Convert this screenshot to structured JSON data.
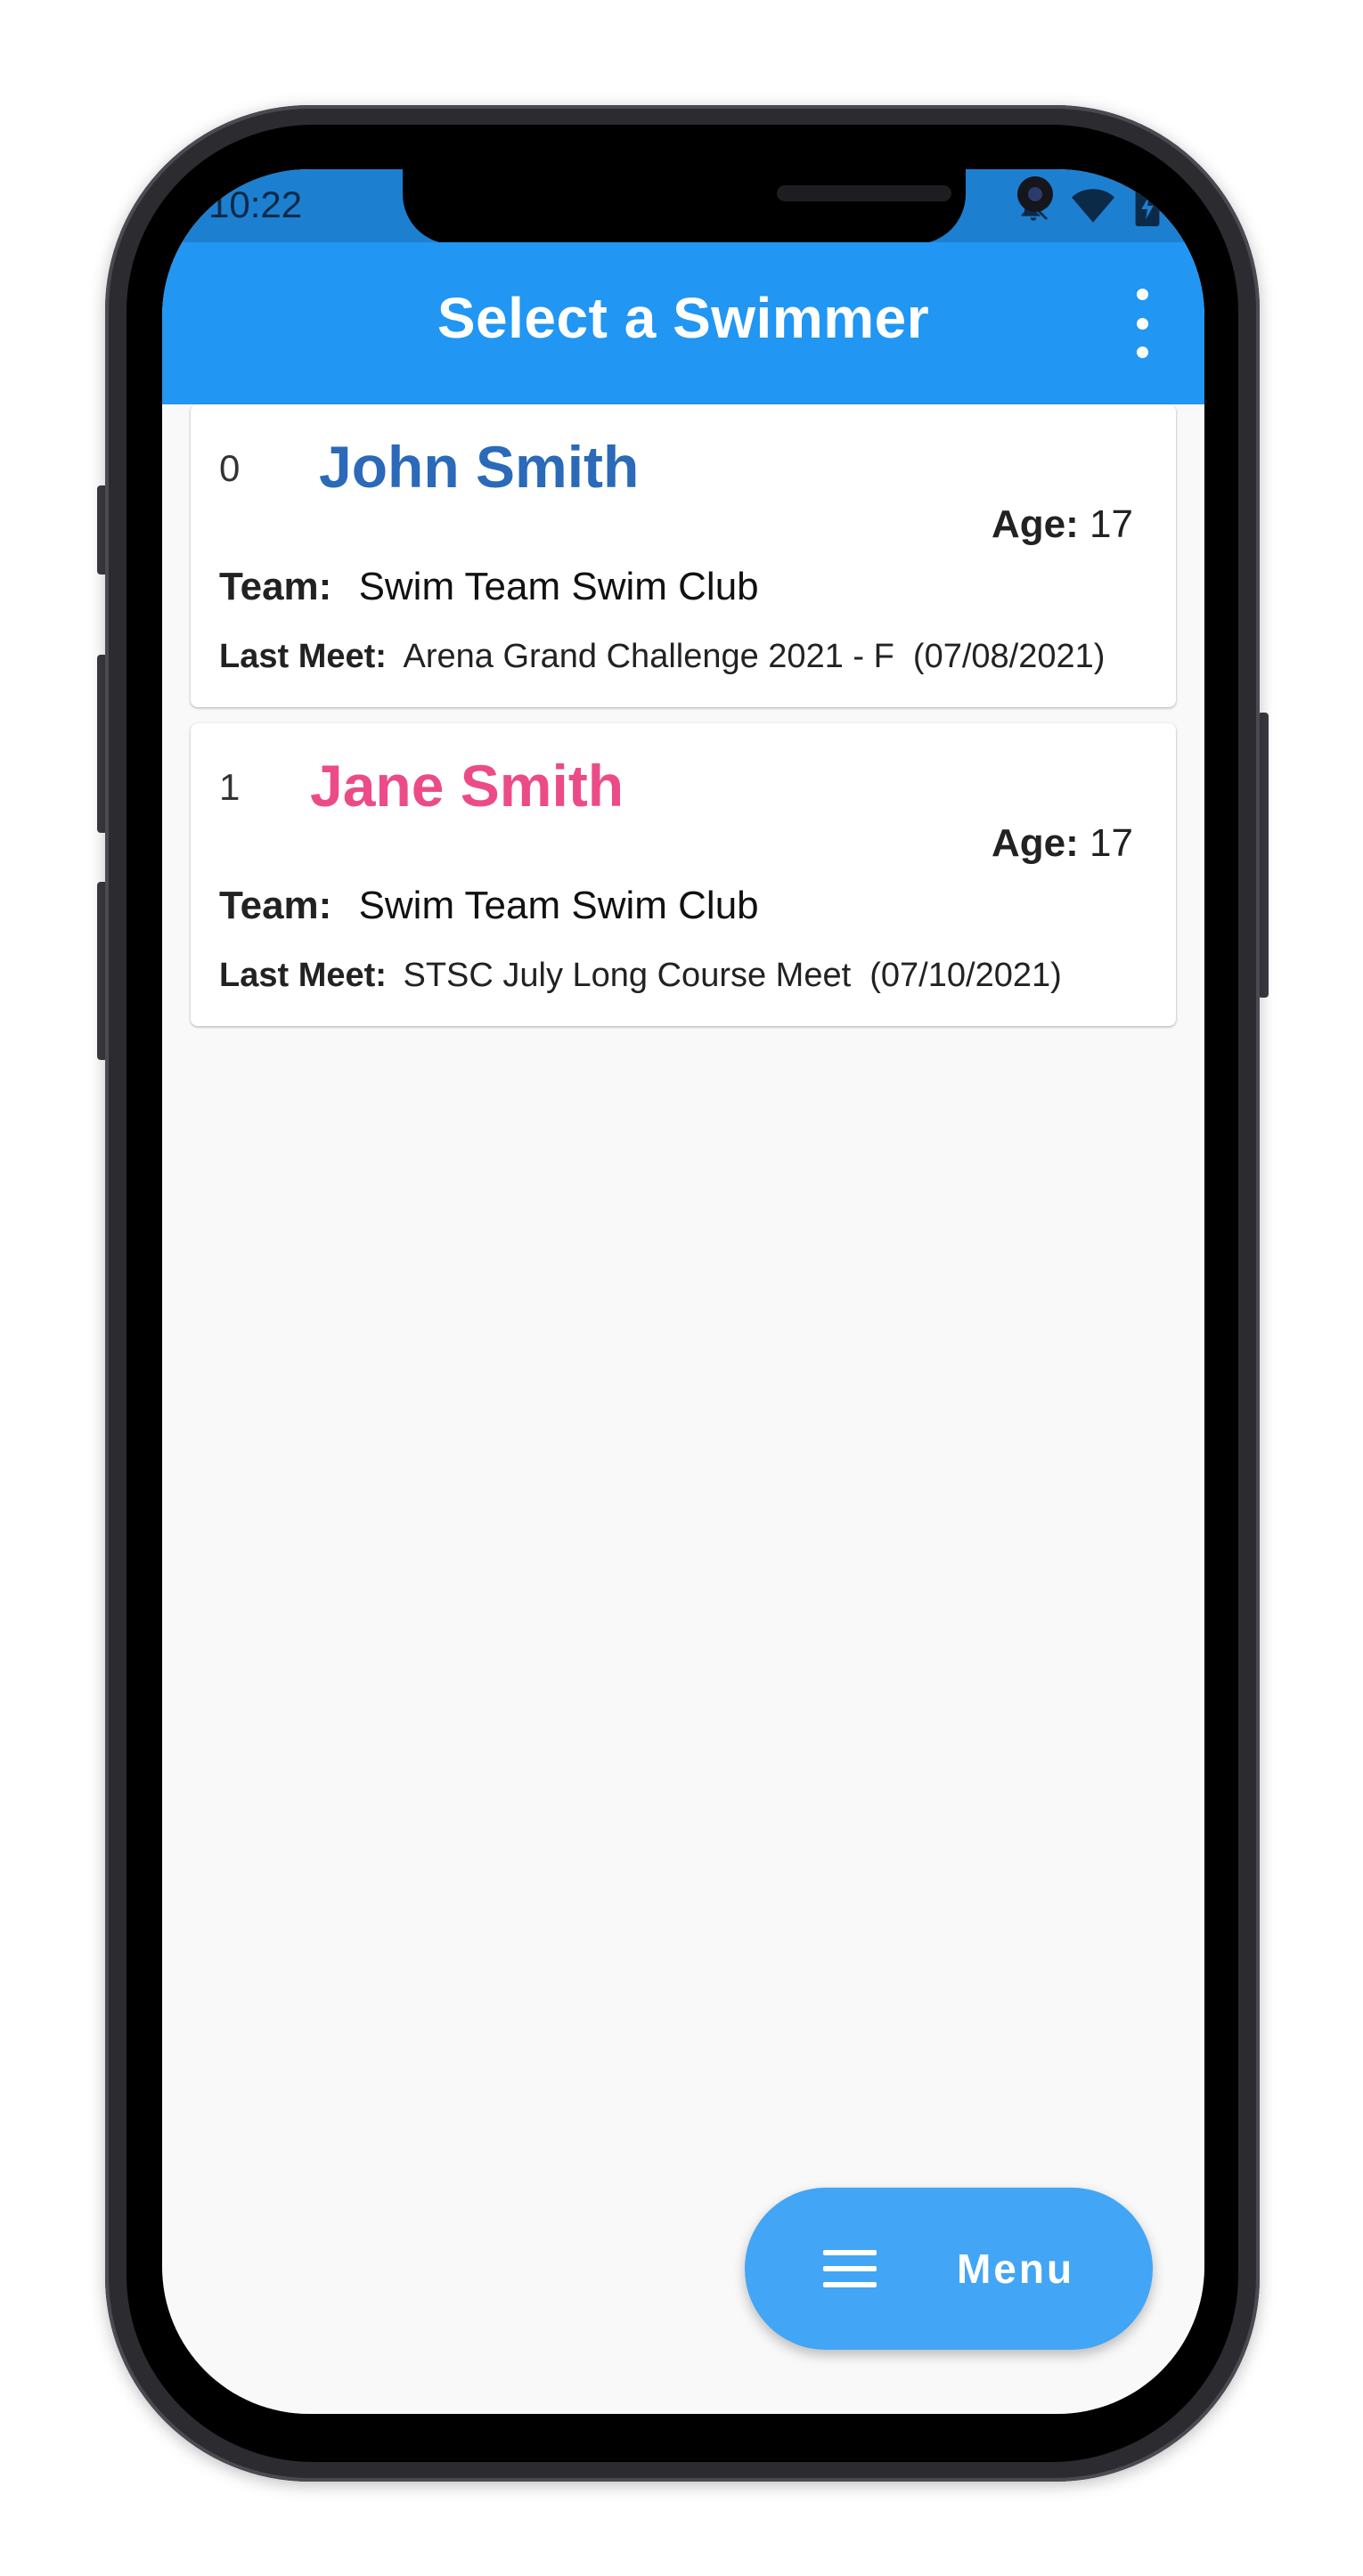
{
  "status_bar": {
    "time": "10:22",
    "icons": [
      "notifications-off-icon",
      "wifi-icon",
      "battery-charging-icon"
    ]
  },
  "app_bar": {
    "title": "Select a Swimmer",
    "menu_icon": "more-vert-icon"
  },
  "swimmers": [
    {
      "index": "0",
      "name": "John Smith",
      "name_color": "#2a6ab8",
      "age_label": "Age:",
      "age": "17",
      "team_label": "Team:",
      "team": "Swim Team Swim Club",
      "last_meet_label": "Last Meet:",
      "last_meet": "Arena Grand Challenge 2021 - F  (07/08/2021)"
    },
    {
      "index": "1",
      "name": "Jane Smith",
      "name_color": "#ec4b88",
      "age_label": "Age:",
      "age": "17",
      "team_label": "Team:",
      "team": "Swim Team Swim Club",
      "last_meet_label": "Last Meet:",
      "last_meet": "STSC July Long Course Meet  (07/10/2021)"
    }
  ],
  "fab": {
    "icon": "menu-icon",
    "label": "Menu"
  },
  "colors": {
    "app_bar": "#2196f3",
    "status_bar": "#1d7fd0",
    "fab": "#42a5f5",
    "background": "#f9f9f9"
  }
}
